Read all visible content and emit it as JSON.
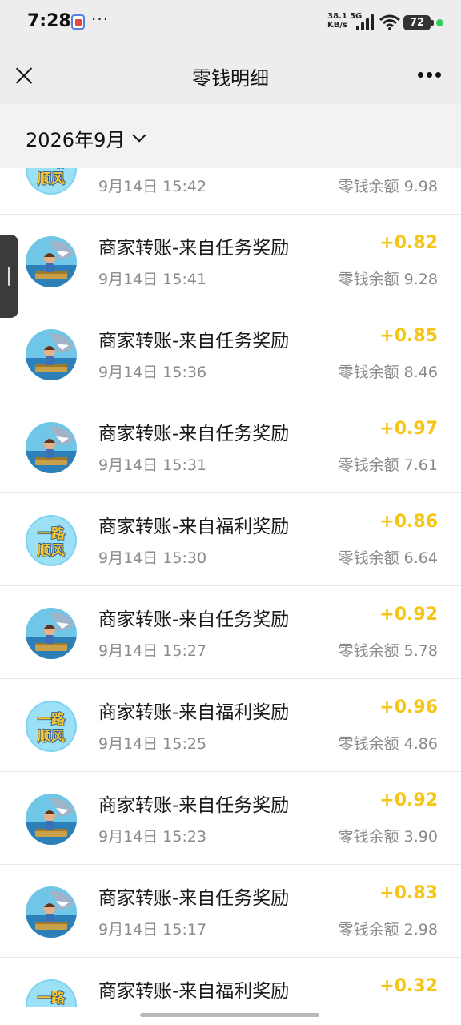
{
  "status_bar": {
    "time": "7:28",
    "more": "···",
    "net_speed_value": "38.1",
    "net_speed_unit": "KB/s",
    "network": "5G",
    "battery": "72"
  },
  "nav": {
    "title": "零钱明细"
  },
  "filter": {
    "month": "2026年9月"
  },
  "colors": {
    "amount": "#f5c518",
    "secondary_text": "#8a8a8a"
  },
  "transactions": [
    {
      "title": "",
      "time": "9月14日 15:42",
      "amount": "",
      "balance": "零钱余额 9.98",
      "avatar": "yilu-shunfeng-logo"
    },
    {
      "title": "商家转账-来自任务奖励",
      "time": "9月14日 15:41",
      "amount": "+0.82",
      "balance": "零钱余额 9.28",
      "avatar": "shark-game-logo"
    },
    {
      "title": "商家转账-来自任务奖励",
      "time": "9月14日 15:36",
      "amount": "+0.85",
      "balance": "零钱余额 8.46",
      "avatar": "shark-game-logo"
    },
    {
      "title": "商家转账-来自任务奖励",
      "time": "9月14日 15:31",
      "amount": "+0.97",
      "balance": "零钱余额 7.61",
      "avatar": "shark-game-logo"
    },
    {
      "title": "商家转账-来自福利奖励",
      "time": "9月14日 15:30",
      "amount": "+0.86",
      "balance": "零钱余额 6.64",
      "avatar": "yilu-shunfeng-logo"
    },
    {
      "title": "商家转账-来自任务奖励",
      "time": "9月14日 15:27",
      "amount": "+0.92",
      "balance": "零钱余额 5.78",
      "avatar": "shark-game-logo"
    },
    {
      "title": "商家转账-来自福利奖励",
      "time": "9月14日 15:25",
      "amount": "+0.96",
      "balance": "零钱余额 4.86",
      "avatar": "yilu-shunfeng-logo"
    },
    {
      "title": "商家转账-来自任务奖励",
      "time": "9月14日 15:23",
      "amount": "+0.92",
      "balance": "零钱余额 3.90",
      "avatar": "shark-game-logo"
    },
    {
      "title": "商家转账-来自任务奖励",
      "time": "9月14日 15:17",
      "amount": "+0.83",
      "balance": "零钱余额 2.98",
      "avatar": "shark-game-logo"
    },
    {
      "title": "商家转账-来自福利奖励",
      "time": "",
      "amount": "+0.32",
      "balance": "",
      "avatar": "yilu-shunfeng-logo"
    }
  ],
  "logos": {
    "yilu_line1": "一路",
    "yilu_line2": "顺风"
  }
}
